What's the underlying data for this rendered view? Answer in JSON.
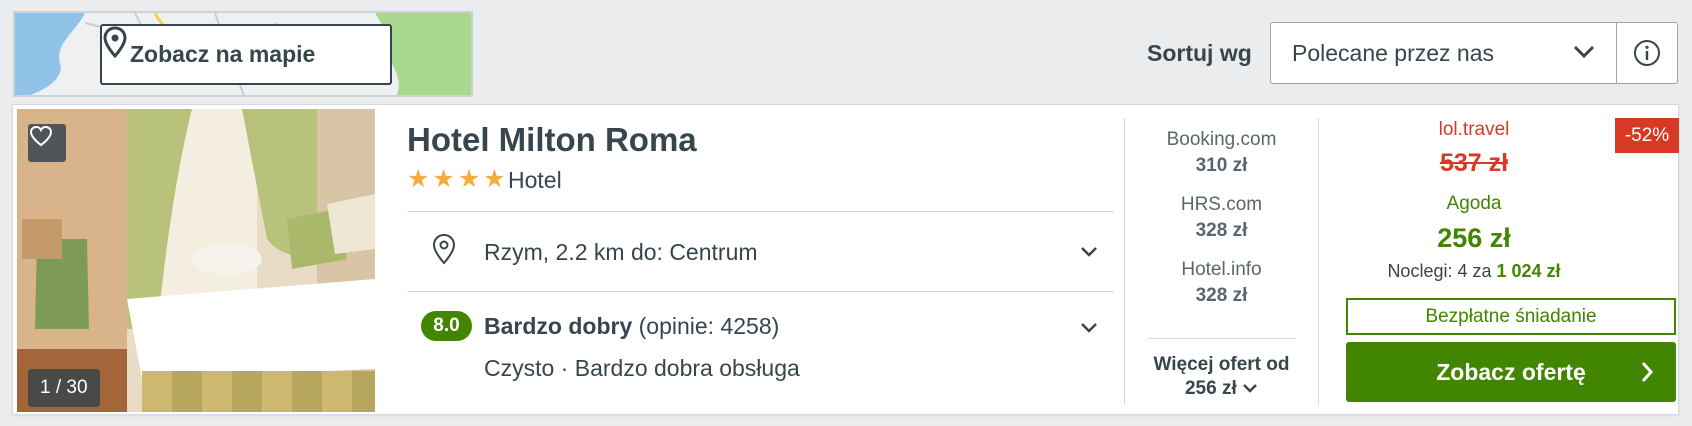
{
  "map": {
    "button_label": "Zobacz na mapie",
    "icon": "map-pin-icon"
  },
  "sort": {
    "label": "Sortuj wg",
    "selected": "Polecane przez nas",
    "info_icon": "info-icon"
  },
  "hotel": {
    "photo_counter": "1 / 30",
    "name": "Hotel Milton Roma",
    "stars": 4,
    "type": "Hotel",
    "location": "Rzym, 2.2 km do: Centrum",
    "rating": {
      "score": "8.0",
      "label": "Bardzo dobry",
      "reviews": "(opinie: 4258)",
      "highlights": "Czysto · Bardzo dobra obsługa"
    }
  },
  "offers": [
    {
      "site": "Booking.com",
      "price": "310 zł"
    },
    {
      "site": "HRS.com",
      "price": "328 zł"
    },
    {
      "site": "Hotel.info",
      "price": "328 zł"
    }
  ],
  "more_offers": {
    "line1": "Więcej ofert od",
    "line2": "256 zł"
  },
  "deal": {
    "discount": "-52%",
    "old_site": "lol.travel",
    "old_price": "537 zł",
    "best_site": "Agoda",
    "best_price": "256 zł",
    "nights_prefix": "Noclegi: 4 za",
    "nights_total": "1 024 zł",
    "breakfast": "Bezpłatne śniadanie",
    "cta": "Zobacz ofertę"
  },
  "colors": {
    "green": "#428500",
    "red": "#d83925",
    "text": "#37454d",
    "star": "#f6ab3f"
  }
}
